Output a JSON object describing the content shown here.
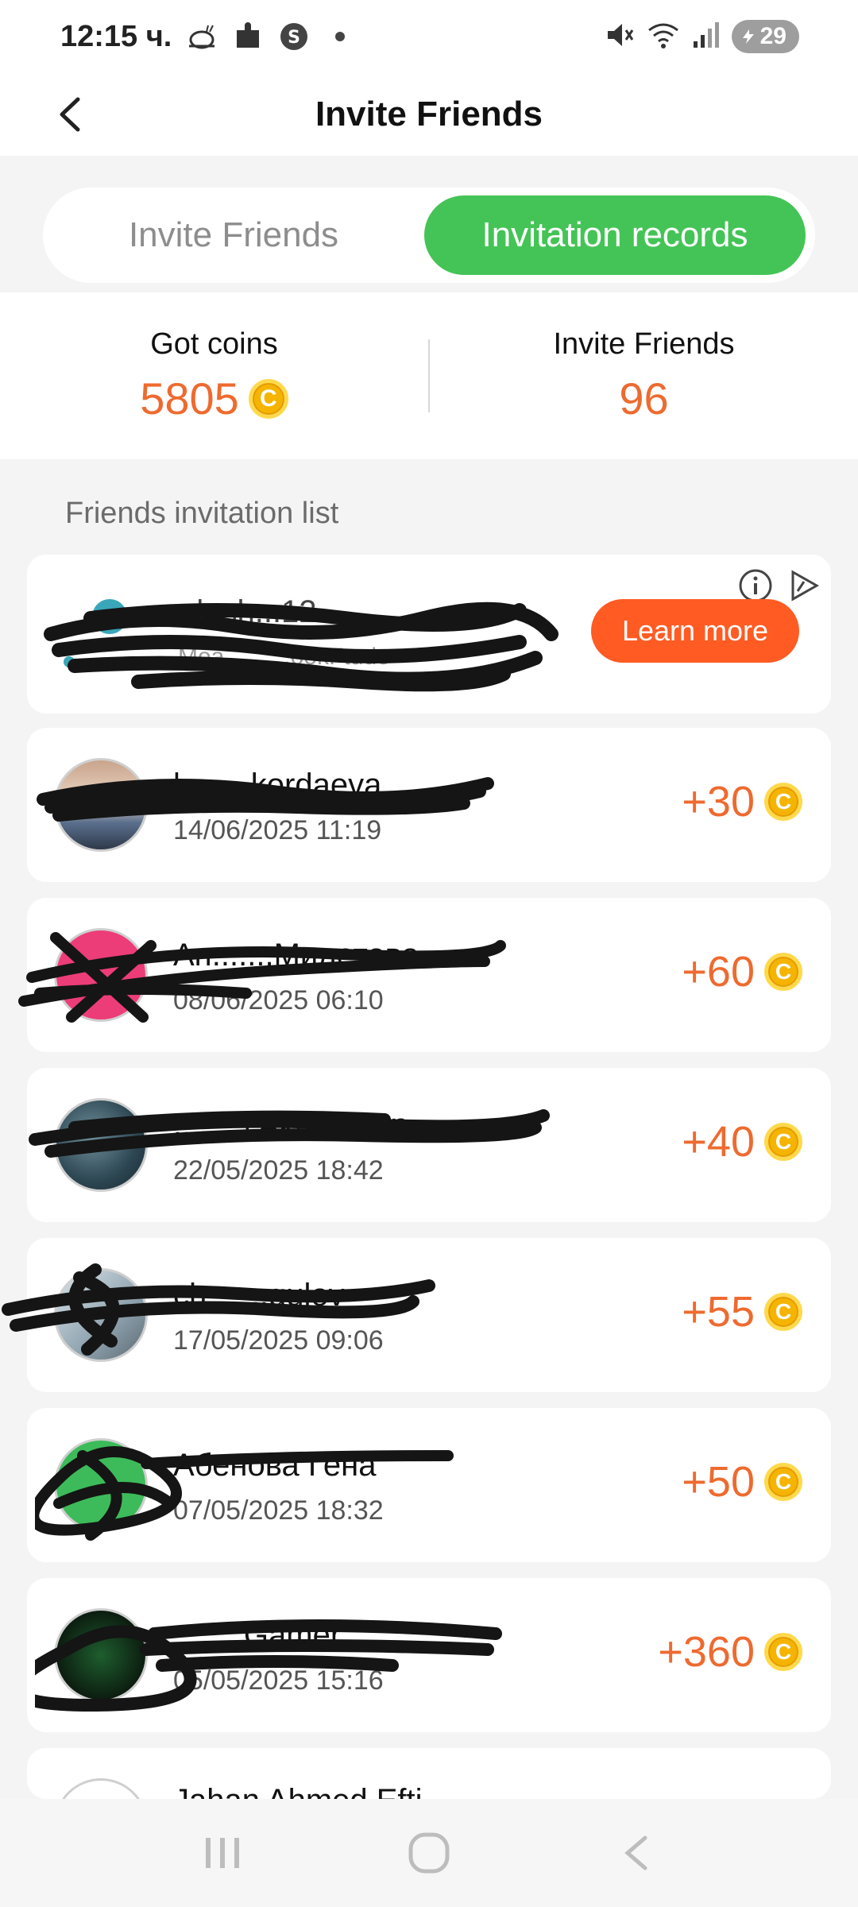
{
  "status_bar": {
    "time": "12:15 ч.",
    "battery": "29",
    "left_icons": [
      "snail-icon",
      "puzzle-icon",
      "s-badge-icon",
      "dot-icon"
    ],
    "right_icons": [
      "mute-icon",
      "wifi-icon",
      "signal-icon",
      "battery-icon"
    ]
  },
  "header": {
    "title": "Invite Friends"
  },
  "tabs": [
    {
      "label": "Invite Friends",
      "active": false
    },
    {
      "label": "Invitation records",
      "active": true
    }
  ],
  "stats": {
    "coins_label": "Got coins",
    "coins_value": "5805",
    "friends_label": "Invite Friends",
    "friends_value": "96"
  },
  "list": {
    "title": "Friends invitation list"
  },
  "ad": {
    "button_label": "Learn more",
    "name": "...lash...12",
    "subtitle": "Mea..........ookFtude"
  },
  "friends": [
    {
      "name": "l........kordaeva",
      "date": "14/06/2025 11:19",
      "reward": "+30"
    },
    {
      "name": "Ан.......Милетова",
      "date": "08/06/2025 06:10",
      "reward": "+60"
    },
    {
      "name": "........l Akh...khan",
      "date": "22/05/2025 18:42",
      "reward": "+40"
    },
    {
      "name": "ch.......gulov",
      "date": "17/05/2025 09:06",
      "reward": "+55"
    },
    {
      "name": "Абенова Гена",
      "date": "07/05/2025 18:32",
      "reward": "+50"
    },
    {
      "name": "........Gamer",
      "date": "05/05/2025 15:16",
      "reward": "+360"
    },
    {
      "name": "Jahan Ahmed Efti",
      "date": "",
      "reward": ""
    }
  ],
  "coin_symbol": "C",
  "colors": {
    "accent_green": "#44c456",
    "accent_orange": "#ee6a2f",
    "button_orange": "#ff5b23",
    "coin_gold": "#f5b400"
  }
}
